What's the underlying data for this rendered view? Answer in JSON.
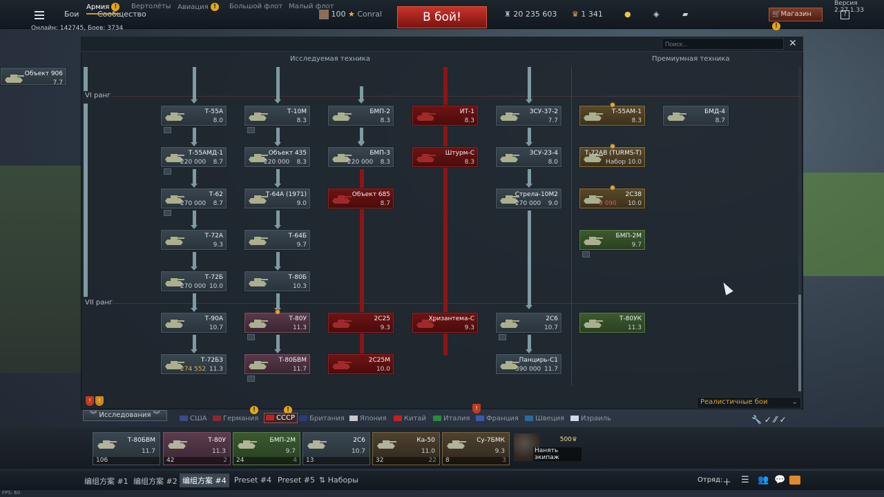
{
  "topbar": {
    "menu_1": "Бои",
    "menu_2": "Сообщество",
    "level": "100",
    "player": "Conral",
    "battle_button": "В бой!",
    "silver_lions": "20 235 603",
    "golden_eagles": "1 341",
    "shop": "Магазин",
    "shop_badge": "!",
    "help": "?",
    "version": "Версия 2.27.1.33",
    "online": "Онлайн: 142745, Боев: 3734"
  },
  "tabs": [
    {
      "label": "Армия",
      "badge": "!"
    },
    {
      "label": "Вертолёты"
    },
    {
      "label": "Авиация",
      "badge": "!"
    },
    {
      "label": "Большой флот"
    },
    {
      "label": "Малый флот"
    }
  ],
  "search": {
    "placeholder": "Поиск..."
  },
  "columns": {
    "researchable": "Исследуемая техника",
    "premium": "Премиумная техника"
  },
  "ranks": [
    "VI ранг",
    "VII ранг"
  ],
  "tree": {
    "r0": {
      "name": "Объект 906",
      "br": "7.7"
    },
    "a1": {
      "name": "Т-55А",
      "br": "8.0"
    },
    "a2": {
      "name": "Т-55АМД-1",
      "cost": "220 000",
      "br": "8.7"
    },
    "a3": {
      "name": "Т-62",
      "cost": "270 000",
      "br": "8.7"
    },
    "a4": {
      "name": "Т-72А",
      "br": "9.3"
    },
    "a5": {
      "name": "Т-72Б",
      "cost": "270 000",
      "br": "10.0"
    },
    "a6": {
      "name": "Т-90А",
      "br": "10.7"
    },
    "a7": {
      "name": "Т-72Б3",
      "cost": "274 552",
      "br": "11.3"
    },
    "b1": {
      "name": "Т-10М",
      "br": "8.3"
    },
    "b2": {
      "name": "Объект 435",
      "cost": "220 000",
      "br": "8.3"
    },
    "b3": {
      "name": "Т-64А (1971)",
      "br": "9.0"
    },
    "b4": {
      "name": "Т-64Б",
      "br": "9.7"
    },
    "b5": {
      "name": "Т-80Б",
      "br": "10.3"
    },
    "b6": {
      "name": "Т-80У",
      "br": "11.3"
    },
    "b7": {
      "name": "Т-80БВМ",
      "br": "11.7"
    },
    "c1": {
      "name": "БМП-2",
      "br": "8.3"
    },
    "c2": {
      "name": "БМП-3",
      "cost": "220 000",
      "br": "8.3"
    },
    "c3": {
      "name": "Объект 685",
      "br": "8.7"
    },
    "c6": {
      "name": "2С25",
      "br": "9.3"
    },
    "c7": {
      "name": "2С25М",
      "br": "10.0"
    },
    "d1": {
      "name": "ИТ-1",
      "br": "8.3"
    },
    "d2": {
      "name": "Штурм-С",
      "br": "8.3"
    },
    "d6": {
      "name": "Хризантема-С",
      "br": "9.3"
    },
    "e1": {
      "name": "ЗСУ-37-2",
      "br": "7.7"
    },
    "e2": {
      "name": "ЗСУ-23-4",
      "br": "8.0"
    },
    "e3": {
      "name": "Стрела-10М2",
      "cost": "270 000",
      "br": "9.0"
    },
    "e6": {
      "name": "2С6",
      "br": "10.7"
    },
    "e7": {
      "name": "Панцирь-С1",
      "cost": "390 000",
      "br": "11.7"
    },
    "p1": {
      "name": "Т-55АМ-1",
      "br": "8.3"
    },
    "p2": {
      "name": "Т-72АВ (TURMS-T)",
      "br": "Набор 10.0"
    },
    "p3": {
      "name": "2С38",
      "cost": "9 090",
      "br": "10.0"
    },
    "p4": {
      "name": "БМП-2М",
      "br": "9.7"
    },
    "p6": {
      "name": "Т-80УК",
      "br": "11.3"
    },
    "q1": {
      "name": "БМД-4",
      "br": "8.7"
    }
  },
  "bottom": {
    "game_mode": "Реалистичные бои",
    "research": "Исследования",
    "nations": [
      "США",
      "Германия",
      "СССР",
      "Британия",
      "Япония",
      "Китай",
      "Италия",
      "Франция",
      "Швеция",
      "Израиль"
    ],
    "crew": [
      {
        "name": "Т-80БВМ",
        "br": "11.7",
        "foot": "106",
        "extra": ""
      },
      {
        "name": "Т-80У",
        "br": "11.3",
        "foot": "42",
        "extra": "2"
      },
      {
        "name": "БМП-2М",
        "br": "9.7",
        "foot": "24",
        "extra": "4"
      },
      {
        "name": "2С6",
        "br": "10.7",
        "foot": "13",
        "extra": ""
      },
      {
        "name": "Ка-50",
        "br": "11.0",
        "foot": "32",
        "extra": "22"
      },
      {
        "name": "Су-7БМК",
        "br": "9.3",
        "foot": "8",
        "extra": "3"
      }
    ],
    "hire": {
      "cost": "500",
      "label": "Нанять экипаж"
    },
    "presets": [
      "编组方案 #1",
      "编组方案 #2",
      "编组方案 #4",
      "Preset #4",
      "Preset #5",
      "Наборы"
    ],
    "squad": "Отряд:",
    "fps": "FPS: 60"
  },
  "colors": {
    "accent": "#d39c2e",
    "battle": "#c7342a",
    "tree_line": "#7e9aa3",
    "red_line": "#8e1414"
  }
}
